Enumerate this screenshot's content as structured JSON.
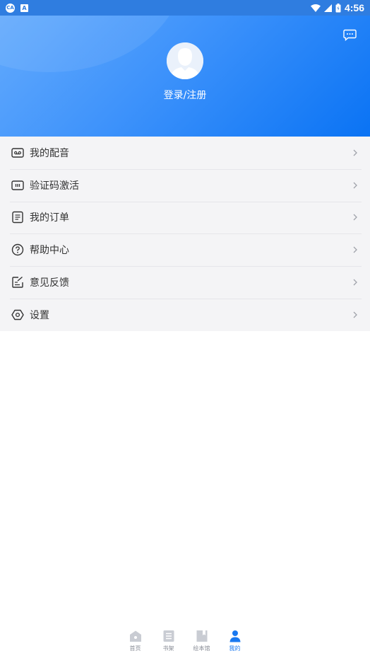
{
  "status_bar": {
    "left_badge_1": "CA",
    "left_badge_2": "A",
    "time": "4:56",
    "icons": [
      "wifi-icon",
      "signal-icon",
      "battery-icon"
    ]
  },
  "header": {
    "login_text": "登录/注册",
    "message_icon": "message-icon",
    "avatar_icon": "default-avatar-icon"
  },
  "menu": {
    "items": [
      {
        "label": "我的配音",
        "icon": "voicemail-icon"
      },
      {
        "label": "验证码激活",
        "icon": "code-card-icon"
      },
      {
        "label": "我的订单",
        "icon": "order-list-icon"
      },
      {
        "label": "帮助中心",
        "icon": "help-icon"
      },
      {
        "label": "意见反馈",
        "icon": "feedback-icon"
      },
      {
        "label": "设置",
        "icon": "settings-icon"
      }
    ]
  },
  "tabbar": {
    "tabs": [
      {
        "label": "首页",
        "icon": "home-icon",
        "active": false
      },
      {
        "label": "书架",
        "icon": "bookshelf-icon",
        "active": false
      },
      {
        "label": "绘本馆",
        "icon": "picture-book-icon",
        "active": false
      },
      {
        "label": "我的",
        "icon": "profile-icon",
        "active": true
      }
    ]
  },
  "colors": {
    "accent": "#1a79f0",
    "header_gradient_start": "#63aafc",
    "header_gradient_end": "#0a73f4",
    "menu_bg": "#f4f4f6",
    "inactive_tab": "#888c96"
  }
}
